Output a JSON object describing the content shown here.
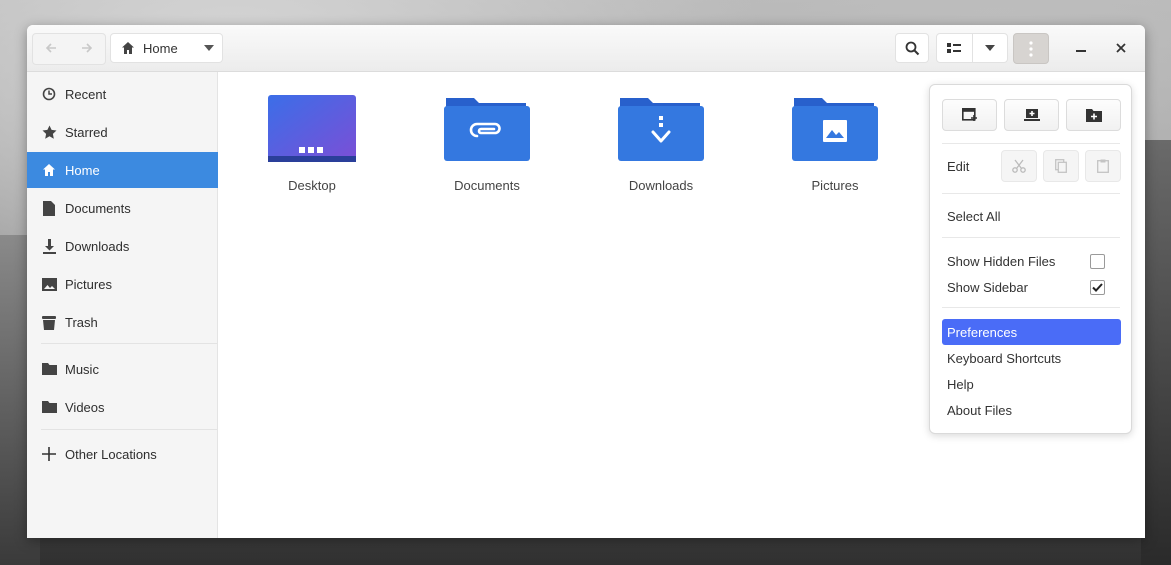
{
  "headerbar": {
    "back_icon": "arrow-left-icon",
    "forward_icon": "arrow-right-icon",
    "path_label": "Home",
    "path_icon": "home-icon",
    "search_icon": "search-icon",
    "view_icon": "list-view-icon",
    "view_options_icon": "chevron-down-icon",
    "menu_icon": "kebab-menu-icon",
    "minimize_icon": "minimize-icon",
    "close_icon": "close-icon"
  },
  "sidebar": {
    "items": [
      {
        "label": "Recent",
        "icon": "clock-icon"
      },
      {
        "label": "Starred",
        "icon": "star-icon"
      },
      {
        "label": "Home",
        "icon": "home-icon",
        "active": true
      },
      {
        "label": "Documents",
        "icon": "document-icon"
      },
      {
        "label": "Downloads",
        "icon": "download-icon"
      },
      {
        "label": "Pictures",
        "icon": "image-icon"
      },
      {
        "label": "Trash",
        "icon": "trash-icon"
      },
      {
        "label": "Music",
        "icon": "folder-icon"
      },
      {
        "label": "Videos",
        "icon": "folder-icon"
      },
      {
        "label": "Other Locations",
        "icon": "plus-icon"
      }
    ]
  },
  "files": [
    {
      "name": "Desktop",
      "icon": "desktop-folder-icon"
    },
    {
      "name": "Documents",
      "icon": "documents-folder-icon"
    },
    {
      "name": "Downloads",
      "icon": "downloads-folder-icon"
    },
    {
      "name": "Pictures",
      "icon": "pictures-folder-icon"
    }
  ],
  "menu": {
    "top_buttons": [
      {
        "icon": "new-window-icon"
      },
      {
        "icon": "new-tab-icon"
      },
      {
        "icon": "new-folder-icon"
      }
    ],
    "edit_label": "Edit",
    "edit_buttons": [
      {
        "icon": "cut-icon"
      },
      {
        "icon": "copy-icon"
      },
      {
        "icon": "paste-icon"
      }
    ],
    "select_all": "Select All",
    "show_hidden_files": {
      "label": "Show Hidden Files",
      "checked": false
    },
    "show_sidebar": {
      "label": "Show Sidebar",
      "checked": true
    },
    "preferences": "Preferences",
    "keyboard_shortcuts": "Keyboard Shortcuts",
    "help": "Help",
    "about": "About Files"
  },
  "colors": {
    "accent": "#3c8ae0",
    "menu_highlight": "#4a6cf7",
    "folder_blue": "#3478e0"
  }
}
